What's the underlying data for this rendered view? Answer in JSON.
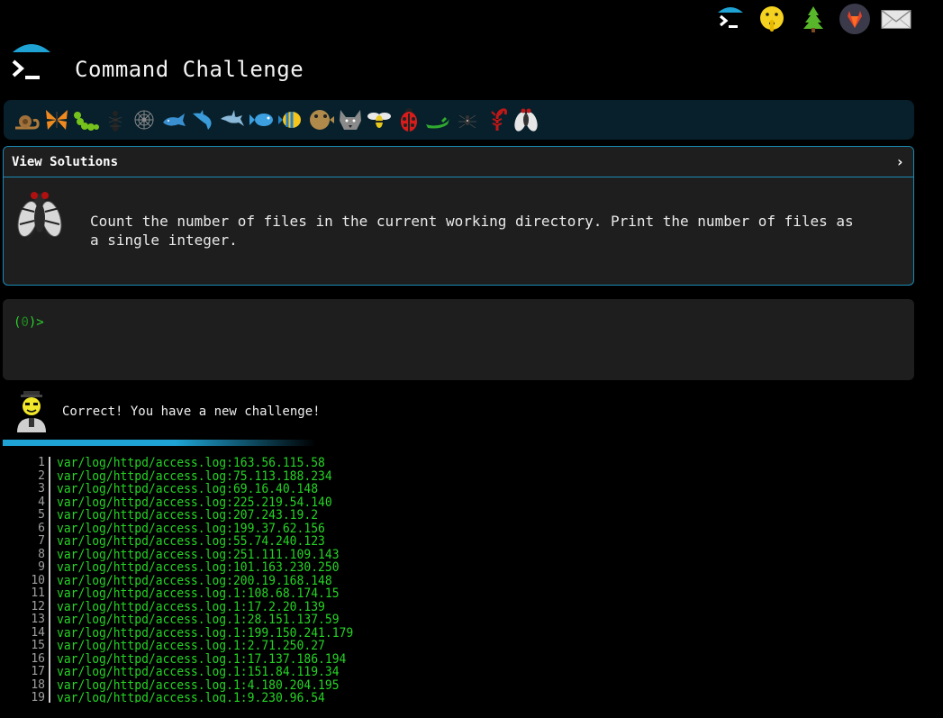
{
  "top_icons": [
    {
      "name": "terminal-icon"
    },
    {
      "name": "shush-face-icon"
    },
    {
      "name": "tree-icon"
    },
    {
      "name": "gitlab-icon"
    },
    {
      "name": "mail-icon"
    }
  ],
  "header": {
    "title": "Command Challenge",
    "logo": "terminal-umbrella-logo"
  },
  "animals": [
    "snail",
    "butterfly",
    "caterpillar",
    "ant",
    "spider-web",
    "whale",
    "shark",
    "dolphin",
    "fish",
    "tropical-fish",
    "blowfish",
    "wolf",
    "bee",
    "ladybug",
    "lizard",
    "spider",
    "scorpion",
    "fly"
  ],
  "challenge": {
    "view_solutions_label": "View Solutions",
    "chevron": "›",
    "text": "Count the number of files in the current working directory. Print the number of files as a single integer."
  },
  "terminal": {
    "prompt_open": "(",
    "prompt_num": "0",
    "prompt_close": ")>"
  },
  "result": {
    "message": "Correct! You have a new challenge!",
    "progress": 0.58
  },
  "output_lines": [
    {
      "n": "1",
      "text": "var/log/httpd/access.log:163.56.115.58"
    },
    {
      "n": "2",
      "text": "var/log/httpd/access.log:75.113.188.234"
    },
    {
      "n": "3",
      "text": "var/log/httpd/access.log:69.16.40.148"
    },
    {
      "n": "4",
      "text": "var/log/httpd/access.log:225.219.54.140"
    },
    {
      "n": "5",
      "text": "var/log/httpd/access.log:207.243.19.2"
    },
    {
      "n": "6",
      "text": "var/log/httpd/access.log:199.37.62.156"
    },
    {
      "n": "7",
      "text": "var/log/httpd/access.log:55.74.240.123"
    },
    {
      "n": "8",
      "text": "var/log/httpd/access.log:251.111.109.143"
    },
    {
      "n": "9",
      "text": "var/log/httpd/access.log:101.163.230.250"
    },
    {
      "n": "10",
      "text": "var/log/httpd/access.log:200.19.168.148"
    },
    {
      "n": "11",
      "text": "var/log/httpd/access.log.1:108.68.174.15"
    },
    {
      "n": "12",
      "text": "var/log/httpd/access.log.1:17.2.20.139"
    },
    {
      "n": "13",
      "text": "var/log/httpd/access.log.1:28.151.137.59"
    },
    {
      "n": "14",
      "text": "var/log/httpd/access.log.1:199.150.241.179"
    },
    {
      "n": "15",
      "text": "var/log/httpd/access.log.1:2.71.250.27"
    },
    {
      "n": "16",
      "text": "var/log/httpd/access.log.1:17.137.186.194"
    },
    {
      "n": "17",
      "text": "var/log/httpd/access.log.1:151.84.119.34"
    },
    {
      "n": "18",
      "text": "var/log/httpd/access.log.1:4.180.204.195"
    },
    {
      "n": "19",
      "text": "var/log/httpd/access.log.1:9.230.96.54"
    }
  ],
  "colors": {
    "accent": "#1a8bb3",
    "panel": "#1e1e1e",
    "animal_bar": "#07202c",
    "output_green": "#25d425"
  }
}
